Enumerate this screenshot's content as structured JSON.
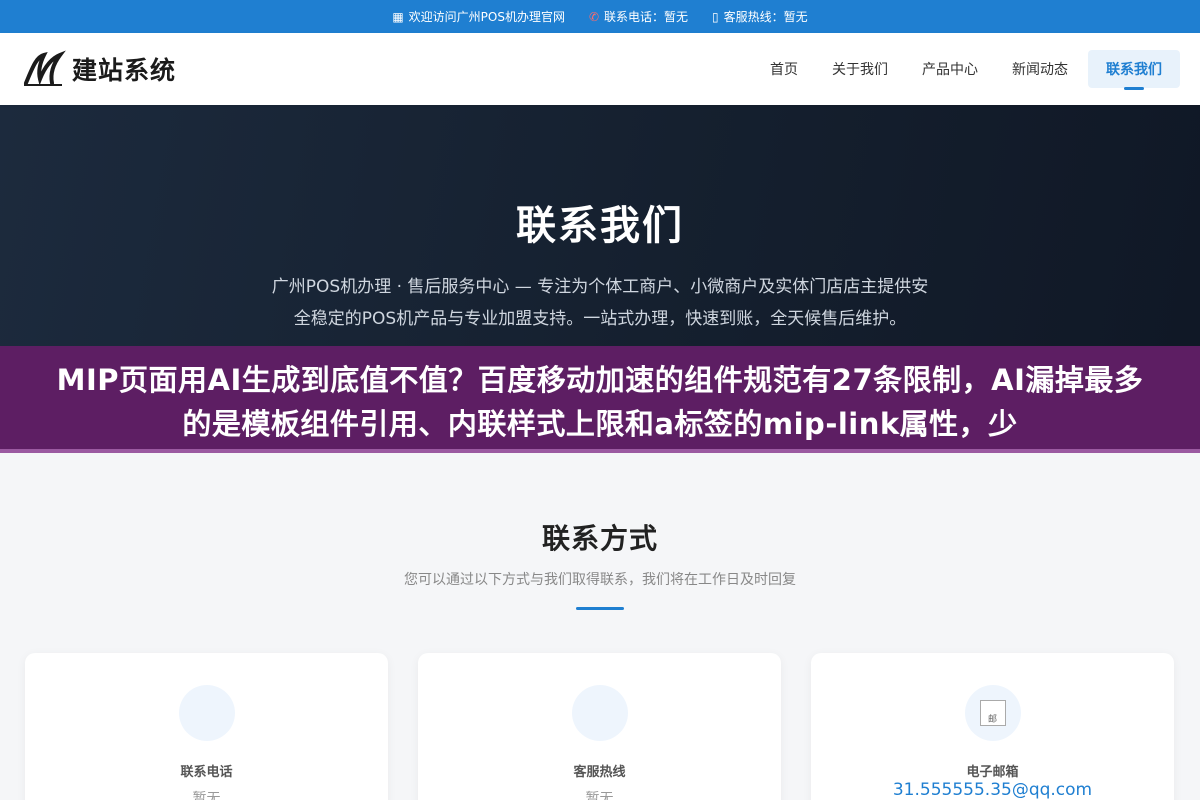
{
  "topbar": {
    "welcome": "欢迎访问广州POS机办理官网",
    "phone": "联系电话：暂无",
    "hotline": "客服热线：暂无"
  },
  "header": {
    "logo_text": "建站系统",
    "nav": [
      {
        "label": "首页"
      },
      {
        "label": "关于我们"
      },
      {
        "label": "产品中心"
      },
      {
        "label": "新闻动态"
      },
      {
        "label": "联系我们"
      }
    ]
  },
  "hero": {
    "title": "联系我们",
    "description": "广州POS机办理 · 售后服务中心 — 专注为个体工商户、小微商户及实体门店店主提供安全稳定的POS机产品与专业加盟支持。一站式办理，快速到账，全天候售后维护。"
  },
  "banner": {
    "text": "MIP页面用AI生成到底值不值？百度移动加速的组件规范有27条限制，AI漏掉最多的是模板组件引用、内联样式上限和a标签的mip-link属性，少"
  },
  "contact": {
    "title": "联系方式",
    "subtitle": "您可以通过以下方式与我们取得联系，我们将在工作日及时回复",
    "cards": [
      {
        "label": "联系电话",
        "value": "暂无"
      },
      {
        "label": "客服热线",
        "value": "暂无"
      },
      {
        "label": "电子邮箱",
        "value": "31.555555.35@qq.com",
        "broken_alt": "邮"
      }
    ]
  },
  "colors": {
    "accent": "#1f7fd1",
    "hero_bg": "#15202f",
    "banner_bg": "#5d1e63"
  }
}
